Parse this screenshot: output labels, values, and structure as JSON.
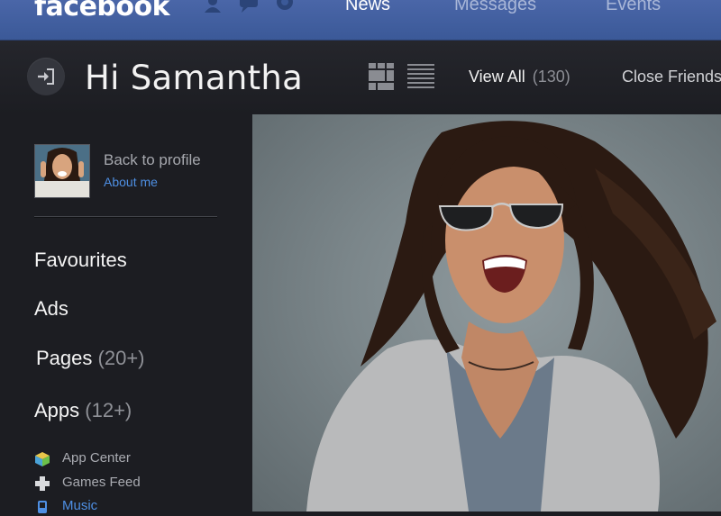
{
  "app": {
    "logo": "facebook"
  },
  "top_nav": {
    "items": [
      {
        "label": "News",
        "active": true
      },
      {
        "label": "Messages",
        "active": false
      },
      {
        "label": "Events",
        "active": false
      }
    ],
    "icons": [
      "friends-icon",
      "messages-icon",
      "notifications-icon"
    ]
  },
  "header": {
    "greeting": "Hi Samantha",
    "view_all_label": "View All",
    "view_all_count": "(130)",
    "close_friends_label": "Close Friends"
  },
  "sidebar": {
    "back_to_profile": "Back to profile",
    "about_me": "About me",
    "items": [
      {
        "label": "Favourites",
        "count": ""
      },
      {
        "label": "Ads",
        "count": ""
      },
      {
        "label": "Pages",
        "count": "(20+)"
      },
      {
        "label": "Apps",
        "count": "(12+)"
      }
    ],
    "sub_items": [
      {
        "label": "App Center",
        "icon": "app-center-icon"
      },
      {
        "label": "Games Feed",
        "icon": "games-feed-icon"
      },
      {
        "label": "Music",
        "icon": "music-icon"
      }
    ]
  },
  "colors": {
    "brand_blue": "#3b5998",
    "background": "#1c1d22",
    "link_blue": "#4e8fe3"
  }
}
